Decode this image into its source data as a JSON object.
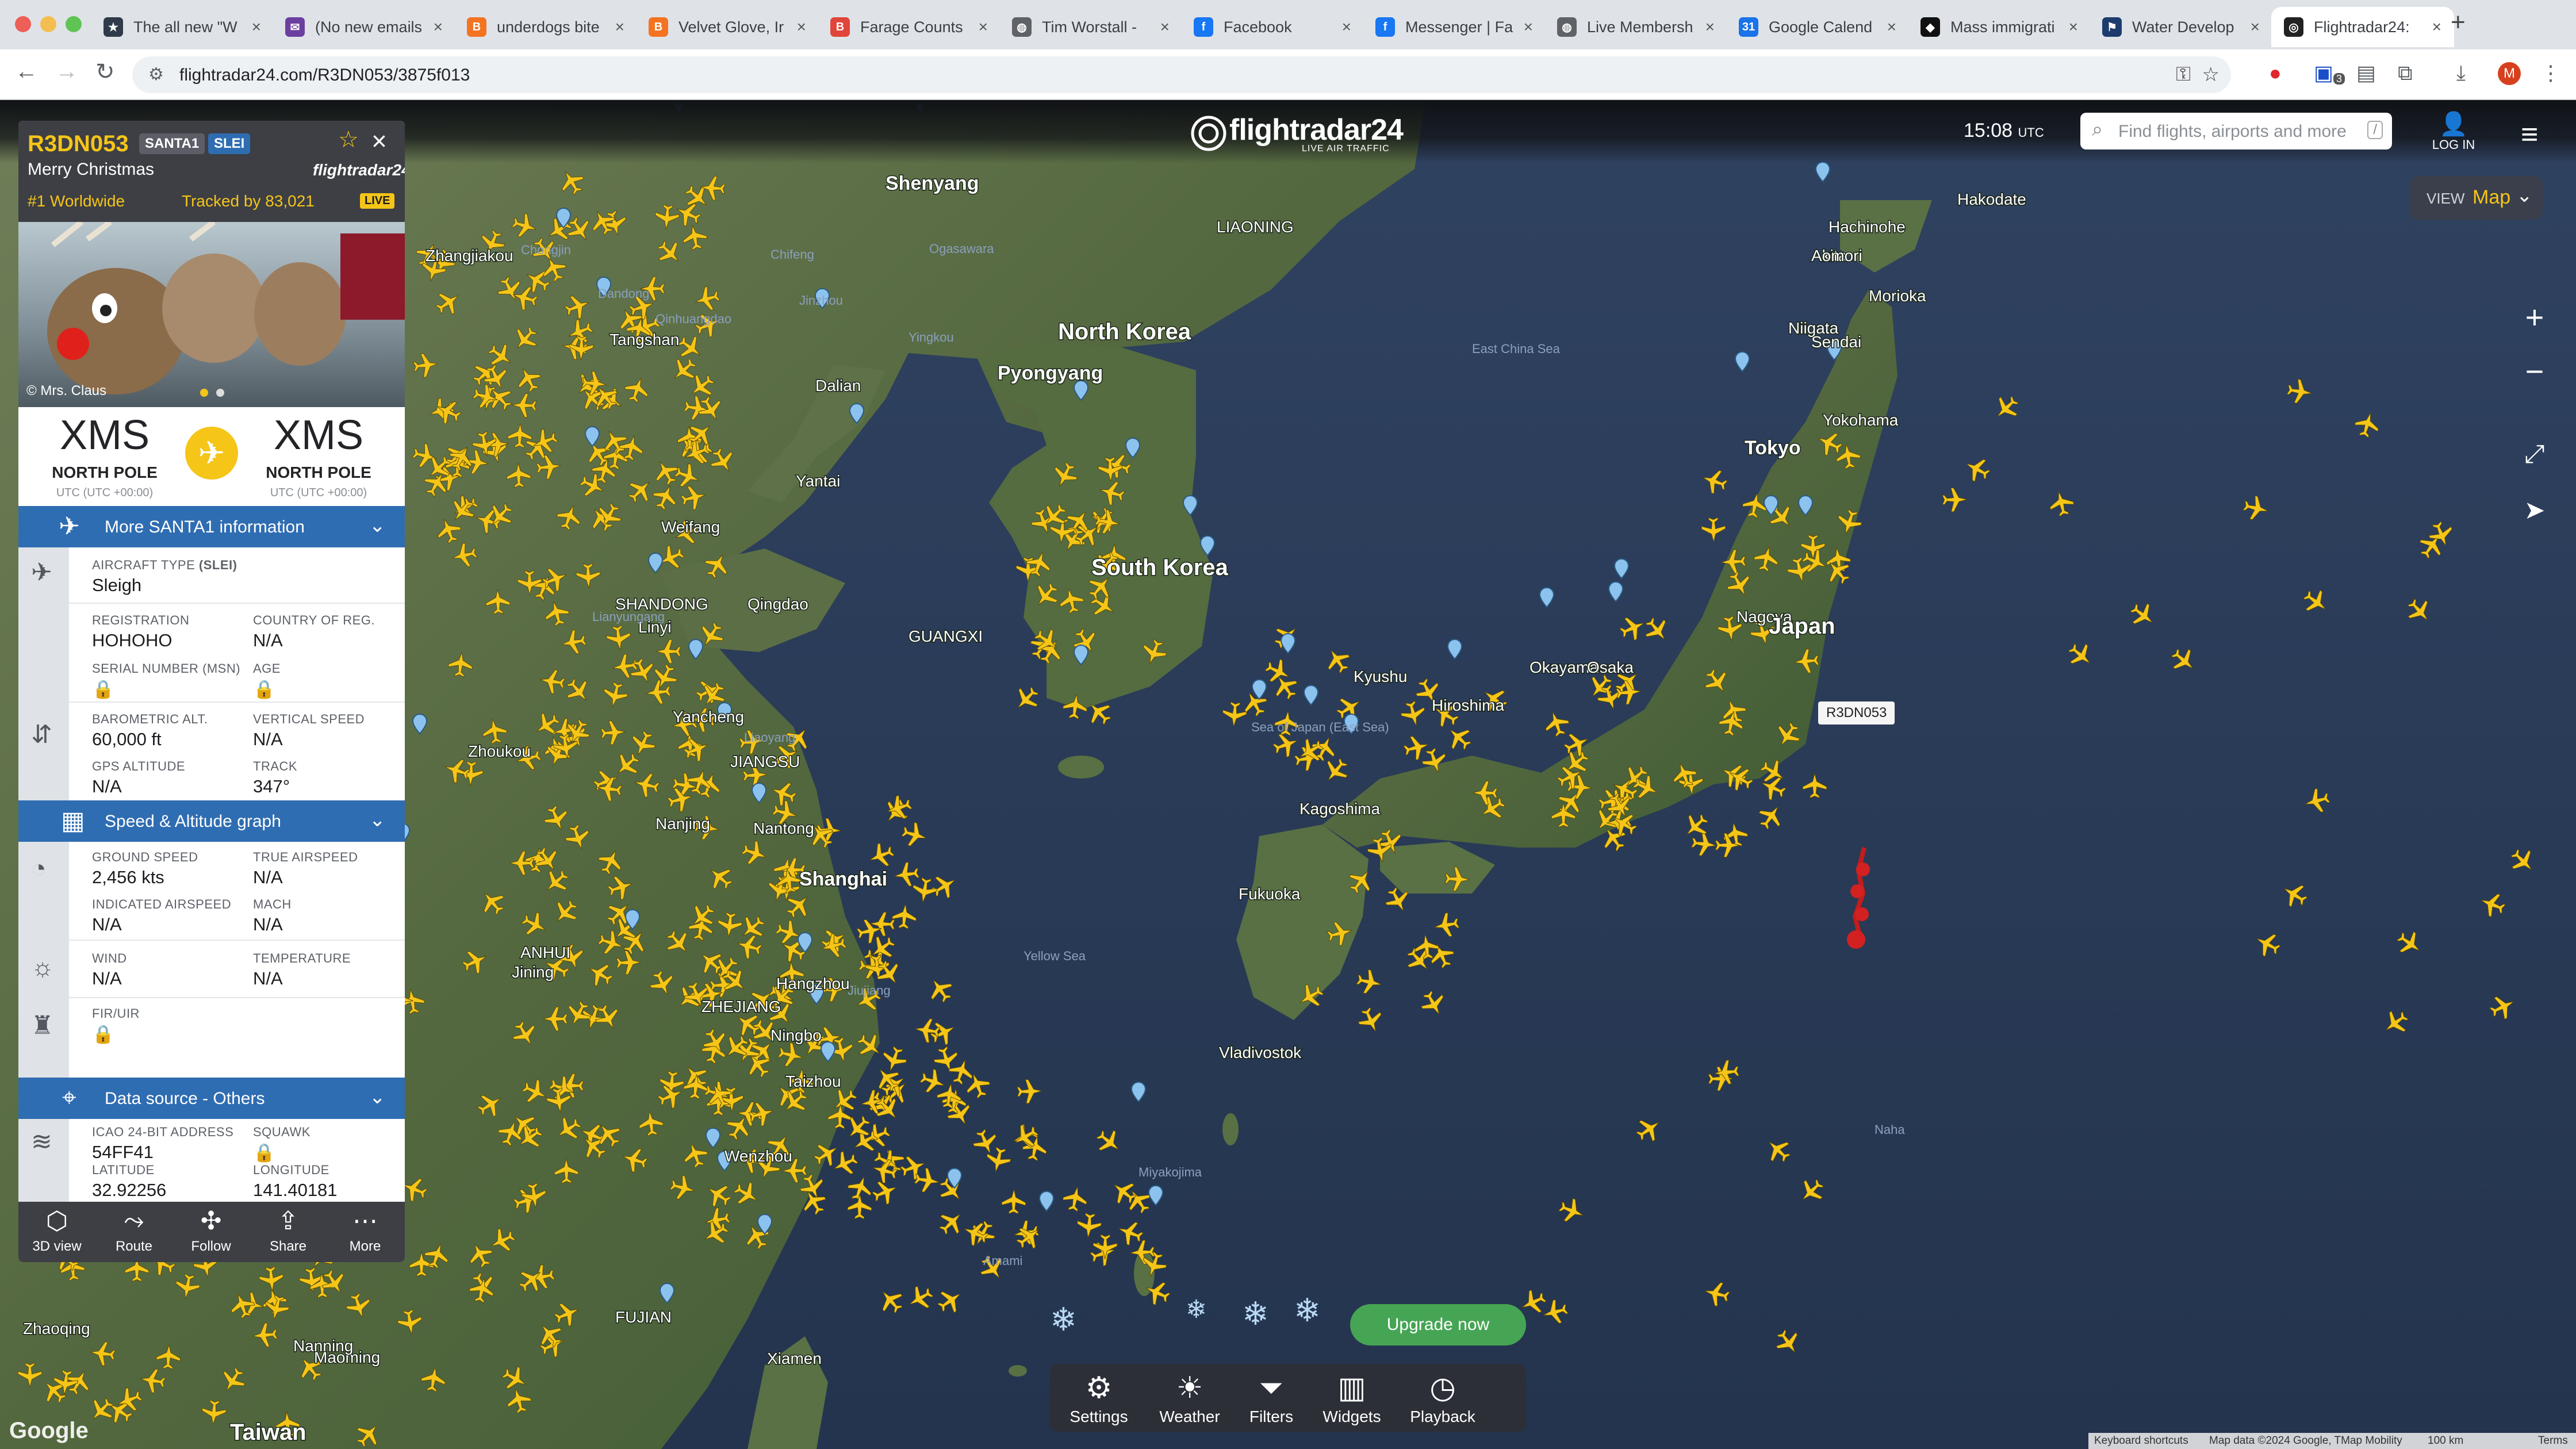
{
  "browser": {
    "tabs": [
      {
        "title": "The all new \"W",
        "icon": "bookmark-icon",
        "color": "#2f3b4a"
      },
      {
        "title": "(No new emails",
        "icon": "mail-icon",
        "color": "#6b3fa0"
      },
      {
        "title": "underdogs bite",
        "icon": "blogger-icon",
        "color": "#f47321"
      },
      {
        "title": "Velvet Glove, Ir",
        "icon": "blogger-icon",
        "color": "#f47321"
      },
      {
        "title": "Farage Counts",
        "icon": "b-icon",
        "color": "#e0453a"
      },
      {
        "title": "Tim Worstall - ",
        "icon": "globe-icon",
        "color": "#5f6368"
      },
      {
        "title": "Facebook",
        "icon": "facebook-icon",
        "color": "#1877f2"
      },
      {
        "title": "Messenger | Fa",
        "icon": "facebook-icon",
        "color": "#1877f2"
      },
      {
        "title": "Live Membersh",
        "icon": "globe-icon",
        "color": "#5f6368"
      },
      {
        "title": "Google Calend",
        "icon": "calendar-icon",
        "color": "#1a73e8"
      },
      {
        "title": "Mass immigrati",
        "icon": "diamond-icon",
        "color": "#111111"
      },
      {
        "title": "Water Develop",
        "icon": "gov-icon",
        "color": "#1d3c6e"
      },
      {
        "title": "Flightradar24:",
        "icon": "fr24-icon",
        "color": "#222222"
      }
    ],
    "new_tab": "+",
    "url": "flightradar24.com/R3DN053/3875f013",
    "extension_badge": "3",
    "profile_initial": "M"
  },
  "header": {
    "logo": "flightradar24",
    "tagline": "LIVE AIR TRAFFIC",
    "time": "15:08",
    "time_zone": "UTC",
    "search_placeholder": "Find flights, airports and more",
    "search_shortcut": "/",
    "login_label": "LOG IN",
    "view_label": "VIEW",
    "view_value": "Map"
  },
  "panel": {
    "callsign": "R3DN053",
    "badge_callsign": "SANTA1",
    "badge_type": "SLEI",
    "subtitle": "Merry Christmas",
    "brand": "flightradar24",
    "rank": "#1 Worldwide",
    "tracked": "Tracked by 83,021",
    "live": "LIVE",
    "photo_credit": "© Mrs. Claus",
    "origin": {
      "code": "XMS",
      "city": "NORTH POLE",
      "tz": "UTC (UTC +00:00)"
    },
    "destination": {
      "code": "XMS",
      "city": "NORTH POLE",
      "tz": "UTC (UTC +00:00)"
    },
    "section_more": "More SANTA1 information",
    "aircraft_type_label": "AIRCRAFT TYPE",
    "aircraft_type_code": "(SLEI)",
    "aircraft_type": "Sleigh",
    "registration_label": "REGISTRATION",
    "registration": "HOHOHO",
    "country_label": "COUNTRY OF REG.",
    "country": "N/A",
    "serial_label": "SERIAL NUMBER (MSN)",
    "age_label": "AGE",
    "baro_label": "BAROMETRIC ALT.",
    "baro": "60,000 ft",
    "vspeed_label": "VERTICAL SPEED",
    "vspeed": "N/A",
    "gps_label": "GPS ALTITUDE",
    "gps": "N/A",
    "track_label": "TRACK",
    "track": "347°",
    "section_speed": "Speed & Altitude graph",
    "ground_speed_label": "GROUND SPEED",
    "ground_speed": "2,456 kts",
    "tas_label": "TRUE AIRSPEED",
    "tas": "N/A",
    "ias_label": "INDICATED AIRSPEED",
    "ias": "N/A",
    "mach_label": "MACH",
    "mach": "N/A",
    "wind_label": "WIND",
    "wind": "N/A",
    "temp_label": "TEMPERATURE",
    "temp": "N/A",
    "fir_label": "FIR/UIR",
    "section_source": "Data source - Others",
    "icao_label": "ICAO 24-BIT ADDRESS",
    "icao": "54FF41",
    "squawk_label": "SQUAWK",
    "lat_label": "LATITUDE",
    "lat": "32.92256",
    "lon_label": "LONGITUDE",
    "lon": "141.40181",
    "actions": [
      "3D view",
      "Route",
      "Follow",
      "Share",
      "More"
    ]
  },
  "map": {
    "flight_label": "R3DN053",
    "labels": [
      {
        "text": "Shenyang",
        "size": "lg"
      },
      {
        "text": "North Korea",
        "size": "xl"
      },
      {
        "text": "Pyongyang",
        "size": "lg"
      },
      {
        "text": "South Korea",
        "size": "xl"
      },
      {
        "text": "Dalian",
        "size": "md"
      },
      {
        "text": "Yantai",
        "size": "md"
      },
      {
        "text": "Tangshan",
        "size": "md"
      },
      {
        "text": "Zhangjiakou",
        "size": "md"
      },
      {
        "text": "Weifang",
        "size": "md"
      },
      {
        "text": "Qingdao",
        "size": "md"
      },
      {
        "text": "SHANDONG",
        "size": "md"
      },
      {
        "text": "Linyi",
        "size": "md"
      },
      {
        "text": "Zhoukou",
        "size": "md"
      },
      {
        "text": "JIANGSU",
        "size": "md"
      },
      {
        "text": "Nanjing",
        "size": "md"
      },
      {
        "text": "Nantong",
        "size": "md"
      },
      {
        "text": "Shanghai",
        "size": "lg"
      },
      {
        "text": "Hangzhou",
        "size": "md"
      },
      {
        "text": "Ningbo",
        "size": "md"
      },
      {
        "text": "ANHUI",
        "size": "md"
      },
      {
        "text": "ZHEJIANG",
        "size": "md"
      },
      {
        "text": "Taizhou",
        "size": "md"
      },
      {
        "text": "Wenzhou",
        "size": "md"
      },
      {
        "text": "FUJIAN",
        "size": "md"
      },
      {
        "text": "Xiamen",
        "size": "md"
      },
      {
        "text": "Taiwan",
        "size": "xl"
      },
      {
        "text": "Maoming",
        "size": "md"
      },
      {
        "text": "Zhaoqing",
        "size": "md"
      },
      {
        "text": "Nanning",
        "size": "md"
      },
      {
        "text": "GUANGXI",
        "size": "md"
      },
      {
        "text": "Yellow Sea",
        "size": "sm"
      },
      {
        "text": "East China Sea",
        "size": "sm"
      },
      {
        "text": "Sea of Japan (East Sea)",
        "size": "sm"
      },
      {
        "text": "Fukuoka",
        "size": "md"
      },
      {
        "text": "Kagoshima",
        "size": "md"
      },
      {
        "text": "Kyushu",
        "size": "md"
      },
      {
        "text": "Hiroshima",
        "size": "md"
      },
      {
        "text": "Okayama",
        "size": "md"
      },
      {
        "text": "Osaka",
        "size": "md"
      },
      {
        "text": "Nagoya",
        "size": "md"
      },
      {
        "text": "Japan",
        "size": "xl"
      },
      {
        "text": "Tokyo",
        "size": "lg"
      },
      {
        "text": "Yokohama",
        "size": "md"
      },
      {
        "text": "Niigata",
        "size": "md"
      },
      {
        "text": "Sendai",
        "size": "md"
      },
      {
        "text": "Akita",
        "size": "md"
      },
      {
        "text": "Morioka",
        "size": "md"
      },
      {
        "text": "Aomori",
        "size": "md"
      },
      {
        "text": "Hachinohe",
        "size": "md"
      },
      {
        "text": "Hakodate",
        "size": "md"
      },
      {
        "text": "Vladivostok",
        "size": "md"
      },
      {
        "text": "Amami",
        "size": "sm"
      },
      {
        "text": "Miyakojima",
        "size": "sm"
      },
      {
        "text": "Naha",
        "size": "sm"
      },
      {
        "text": "Ogasawara",
        "size": "sm"
      },
      {
        "text": "LIAONING",
        "size": "md"
      },
      {
        "text": "Chongjin",
        "size": "sm"
      },
      {
        "text": "Chifeng",
        "size": "sm"
      },
      {
        "text": "Jinzhou",
        "size": "sm"
      },
      {
        "text": "Yingkou",
        "size": "sm"
      },
      {
        "text": "Dandong",
        "size": "sm"
      },
      {
        "text": "Qinhuangdao",
        "size": "sm"
      },
      {
        "text": "Liaoyang",
        "size": "sm"
      },
      {
        "text": "Yancheng",
        "size": "md"
      },
      {
        "text": "Lianyungang",
        "size": "sm"
      },
      {
        "text": "Jining",
        "size": "md"
      },
      {
        "text": "Jiujiang",
        "size": "sm"
      },
      {
        "text": "Zhoushan",
        "size": "sm"
      }
    ],
    "colors": {
      "land": "#4f6b3f",
      "sea": "#2b3c57",
      "plane": "#f5c518",
      "pin": "#8cc3ee"
    }
  },
  "bottom": {
    "upgrade": "Upgrade now",
    "buttons": [
      "Settings",
      "Weather",
      "Filters",
      "Widgets",
      "Playback"
    ]
  },
  "footer": {
    "shortcuts": "Keyboard shortcuts",
    "mapdata": "Map data ©2024 Google, TMap Mobility",
    "scale": "100 km",
    "terms": "Terms",
    "google": "Google"
  }
}
